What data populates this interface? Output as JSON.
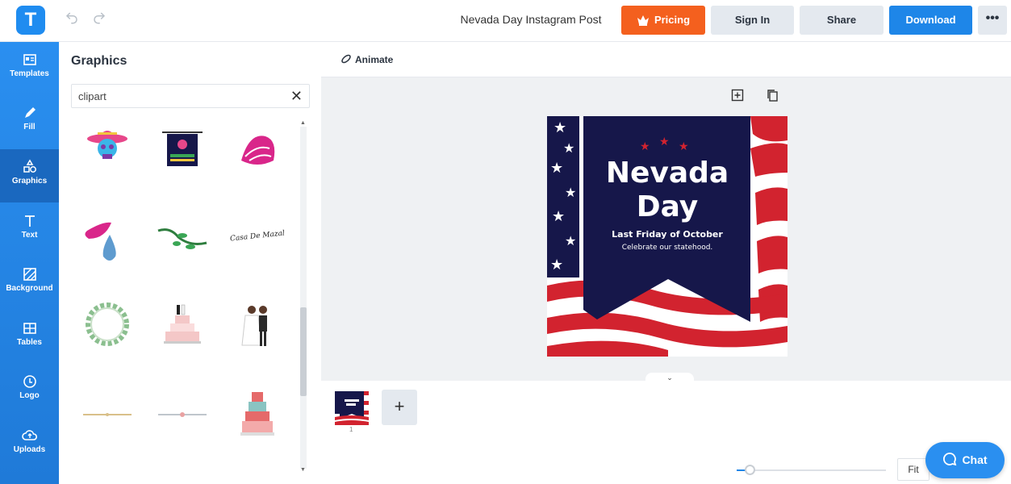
{
  "app": {
    "logo_letter": "T",
    "accent": "#1f8cf0"
  },
  "header": {
    "doc_title": "Nevada Day Instagram Post",
    "pricing_label": "Pricing",
    "signin_label": "Sign In",
    "share_label": "Share",
    "download_label": "Download",
    "more_label": "•••"
  },
  "leftnav": {
    "items": [
      {
        "label": "Templates",
        "icon": "templates-icon"
      },
      {
        "label": "Fill",
        "icon": "pen-icon"
      },
      {
        "label": "Graphics",
        "icon": "shapes-icon",
        "active": true
      },
      {
        "label": "Text",
        "icon": "text-icon"
      },
      {
        "label": "Background",
        "icon": "background-icon"
      },
      {
        "label": "Tables",
        "icon": "table-icon"
      },
      {
        "label": "Logo",
        "icon": "logo-icon"
      },
      {
        "label": "Uploads",
        "icon": "cloud-upload-icon"
      }
    ]
  },
  "panel": {
    "title": "Graphics",
    "search_value": "clipart",
    "clear_label": "✕",
    "graphics": [
      "sugar-skull-sombrero",
      "papel-picado-banner",
      "pink-flower-petals",
      "teardrops",
      "green-leaf-vine",
      "casa-de-mazal-lettering",
      "floral-wreath",
      "wedding-cake-couple",
      "bride-and-groom",
      "gold-divider",
      "pink-divider",
      "tiered-cake"
    ],
    "lettering_text": "Casa De Mazal"
  },
  "canvas": {
    "animate_label": "Animate",
    "design": {
      "title_line1": "Nevada",
      "title_line2": "Day",
      "subtitle": "Last Friday of October",
      "tagline": "Celebrate our statehood.",
      "colors": {
        "navy": "#16174a",
        "red": "#d2232f",
        "white": "#ffffff"
      }
    }
  },
  "pages": {
    "current": "1",
    "add_label": "+"
  },
  "zoom": {
    "fit_label": "Fit"
  },
  "chat": {
    "label": "Chat"
  }
}
